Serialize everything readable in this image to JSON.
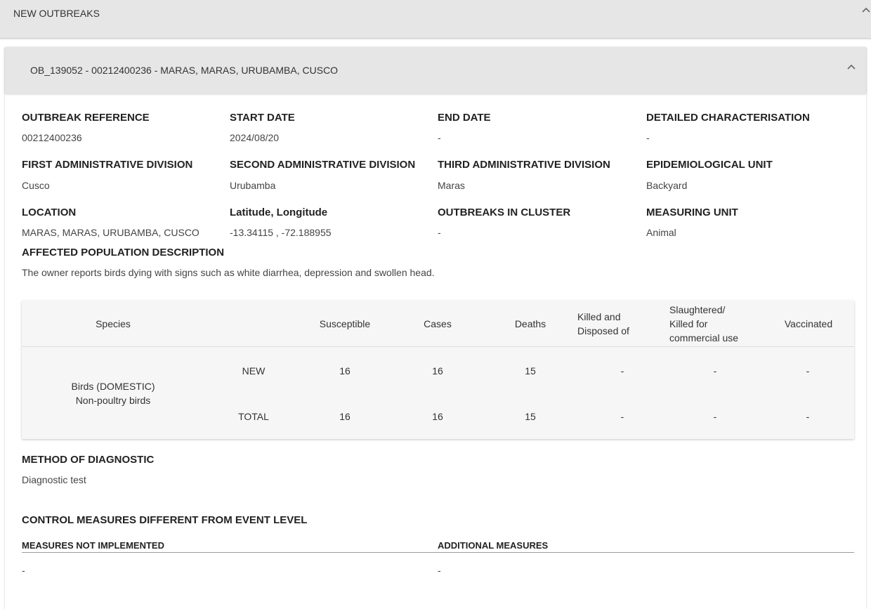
{
  "section": {
    "title": "NEW OUTBREAKS",
    "chevron_icon": "chevron-up-icon"
  },
  "outbreak": {
    "title": "OB_139052 - 00212400236 - MARAS, MARAS, URUBAMBA, CUSCO",
    "chevron_icon": "chevron-up-icon",
    "fields": {
      "outbreak_reference": {
        "label": "OUTBREAK REFERENCE",
        "value": "00212400236"
      },
      "start_date": {
        "label": "START DATE",
        "value": "2024/08/20"
      },
      "end_date": {
        "label": "END DATE",
        "value": "-"
      },
      "detailed_characterisation": {
        "label": "DETAILED CHARACTERISATION",
        "value": "-"
      },
      "first_admin_division": {
        "label": "FIRST ADMINISTRATIVE DIVISION",
        "value": "Cusco"
      },
      "second_admin_division": {
        "label": "SECOND ADMINISTRATIVE DIVISION",
        "value": "Urubamba"
      },
      "third_admin_division": {
        "label": "THIRD ADMINISTRATIVE DIVISION",
        "value": "Maras"
      },
      "epidemiological_unit": {
        "label": "EPIDEMIOLOGICAL UNIT",
        "value": "Backyard"
      },
      "location": {
        "label": "LOCATION",
        "value": "MARAS, MARAS, URUBAMBA, CUSCO"
      },
      "lat_long": {
        "label": "Latitude, Longitude",
        "value": "-13.34115 , -72.188955"
      },
      "outbreaks_in_cluster": {
        "label": "OUTBREAKS IN CLUSTER",
        "value": "-"
      },
      "measuring_unit": {
        "label": "MEASURING UNIT",
        "value": "Animal"
      },
      "affected_population": {
        "label": "AFFECTED POPULATION DESCRIPTION",
        "value": "The owner reports birds dying with signs such as white diarrhea, depression and swollen head."
      }
    },
    "population_table": {
      "headers": {
        "species": "Species",
        "susceptible": "Susceptible",
        "cases": "Cases",
        "deaths": "Deaths",
        "killed_line1": "Killed and",
        "killed_line2": "Disposed of",
        "slaughtered_line1": "Slaughtered/",
        "slaughtered_line2": "Killed for",
        "slaughtered_line3": "commercial use",
        "vaccinated": "Vaccinated"
      },
      "species_line1": "Birds (DOMESTIC)",
      "species_line2": "Non-poultry birds",
      "rows": [
        {
          "type": "NEW",
          "susceptible": "16",
          "cases": "16",
          "deaths": "15",
          "killed": "-",
          "slaughtered": "-",
          "vaccinated": "-"
        },
        {
          "type": "TOTAL",
          "susceptible": "16",
          "cases": "16",
          "deaths": "15",
          "killed": "-",
          "slaughtered": "-",
          "vaccinated": "-"
        }
      ]
    },
    "method_of_diagnostic": {
      "label": "METHOD OF DIAGNOSTIC",
      "value": "Diagnostic test"
    },
    "control_measures": {
      "label": "CONTROL MEASURES DIFFERENT FROM EVENT LEVEL",
      "not_implemented": {
        "label": "MEASURES NOT IMPLEMENTED",
        "value": "-"
      },
      "additional": {
        "label": "ADDITIONAL MEASURES",
        "value": "-"
      }
    }
  }
}
